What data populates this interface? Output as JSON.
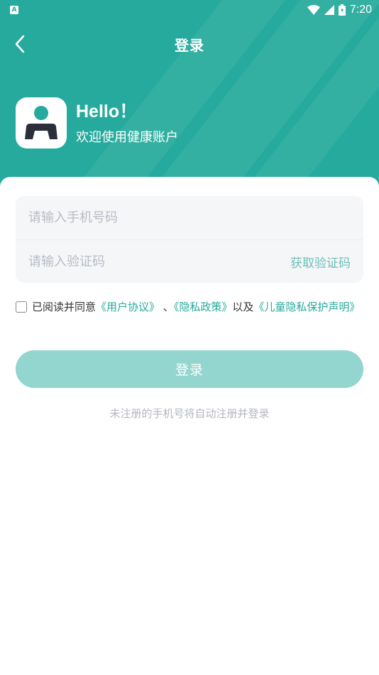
{
  "status_bar": {
    "notification_letter": "A",
    "time": "7:20"
  },
  "nav": {
    "title": "登录"
  },
  "welcome": {
    "hello": "Hello！",
    "subtitle": "欢迎使用健康账户"
  },
  "form": {
    "phone_placeholder": "请输入手机号码",
    "phone_value": "",
    "code_placeholder": "请输入验证码",
    "code_value": "",
    "get_code_label": "获取验证码"
  },
  "agreement": {
    "checked": false,
    "prefix": "已阅读并同意",
    "user_agreement": "《用户协议》",
    "sep": " 、",
    "privacy_policy": "《隐私政策》",
    "and": "以及",
    "child_privacy": "《儿童隐私保护声明》"
  },
  "login_button_label": "登录",
  "hint": "未注册的手机号将自动注册并登录",
  "colors": {
    "primary": "#25aa9d",
    "button_disabled": "#93d5cf",
    "link": "#25aa9d",
    "placeholder": "#b8bcc4"
  }
}
